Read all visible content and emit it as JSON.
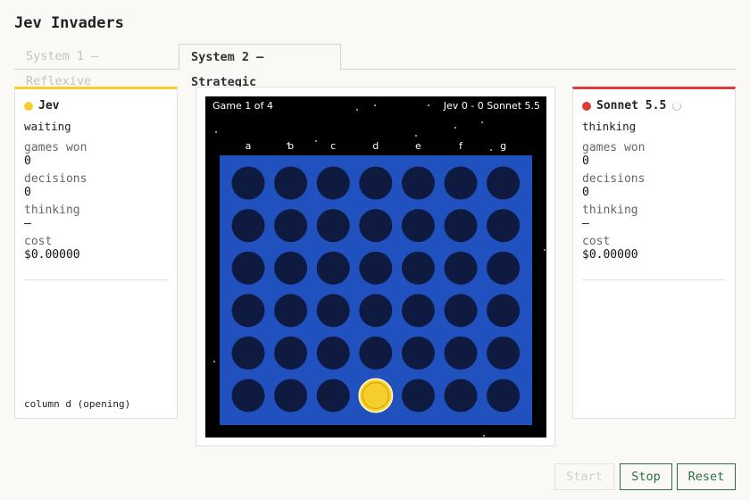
{
  "app": {
    "title": "Jev Invaders"
  },
  "tabs": [
    {
      "label": "System 1 — Reflexive",
      "active": false
    },
    {
      "label": "System 2 — Strategic",
      "active": true
    }
  ],
  "players": [
    {
      "name": "Jev",
      "color": "#f4cf2e",
      "status": "waiting",
      "stats": [
        {
          "label": "games won",
          "value": "0"
        },
        {
          "label": "decisions",
          "value": "0"
        },
        {
          "label": "thinking",
          "value": "–"
        },
        {
          "label": "cost",
          "value": "$0.00000"
        }
      ],
      "footnote": "column d (opening)"
    },
    {
      "name": "Sonnet 5.5",
      "color": "#dc3c3c",
      "status": "thinking",
      "stats": [
        {
          "label": "games won",
          "value": "0"
        },
        {
          "label": "decisions",
          "value": "0"
        },
        {
          "label": "thinking",
          "value": "–"
        },
        {
          "label": "cost",
          "value": "$0.00000"
        }
      ]
    }
  ],
  "game": {
    "label": "Game 1 of 4",
    "score": "Jev 0 - 0 Sonnet 5.5",
    "columns": [
      "a",
      "b",
      "c",
      "d",
      "e",
      "f",
      "g"
    ],
    "rows": 6,
    "board_color": "#2150bf",
    "empty_color": "#0e1a40",
    "pieces": [
      {
        "column": "d",
        "row_from_bottom": 1,
        "player": "Jev",
        "color": "#f4cf2e"
      }
    ]
  },
  "controls": {
    "start_label": "Start",
    "stop_label": "Stop",
    "reset_label": "Reset"
  }
}
